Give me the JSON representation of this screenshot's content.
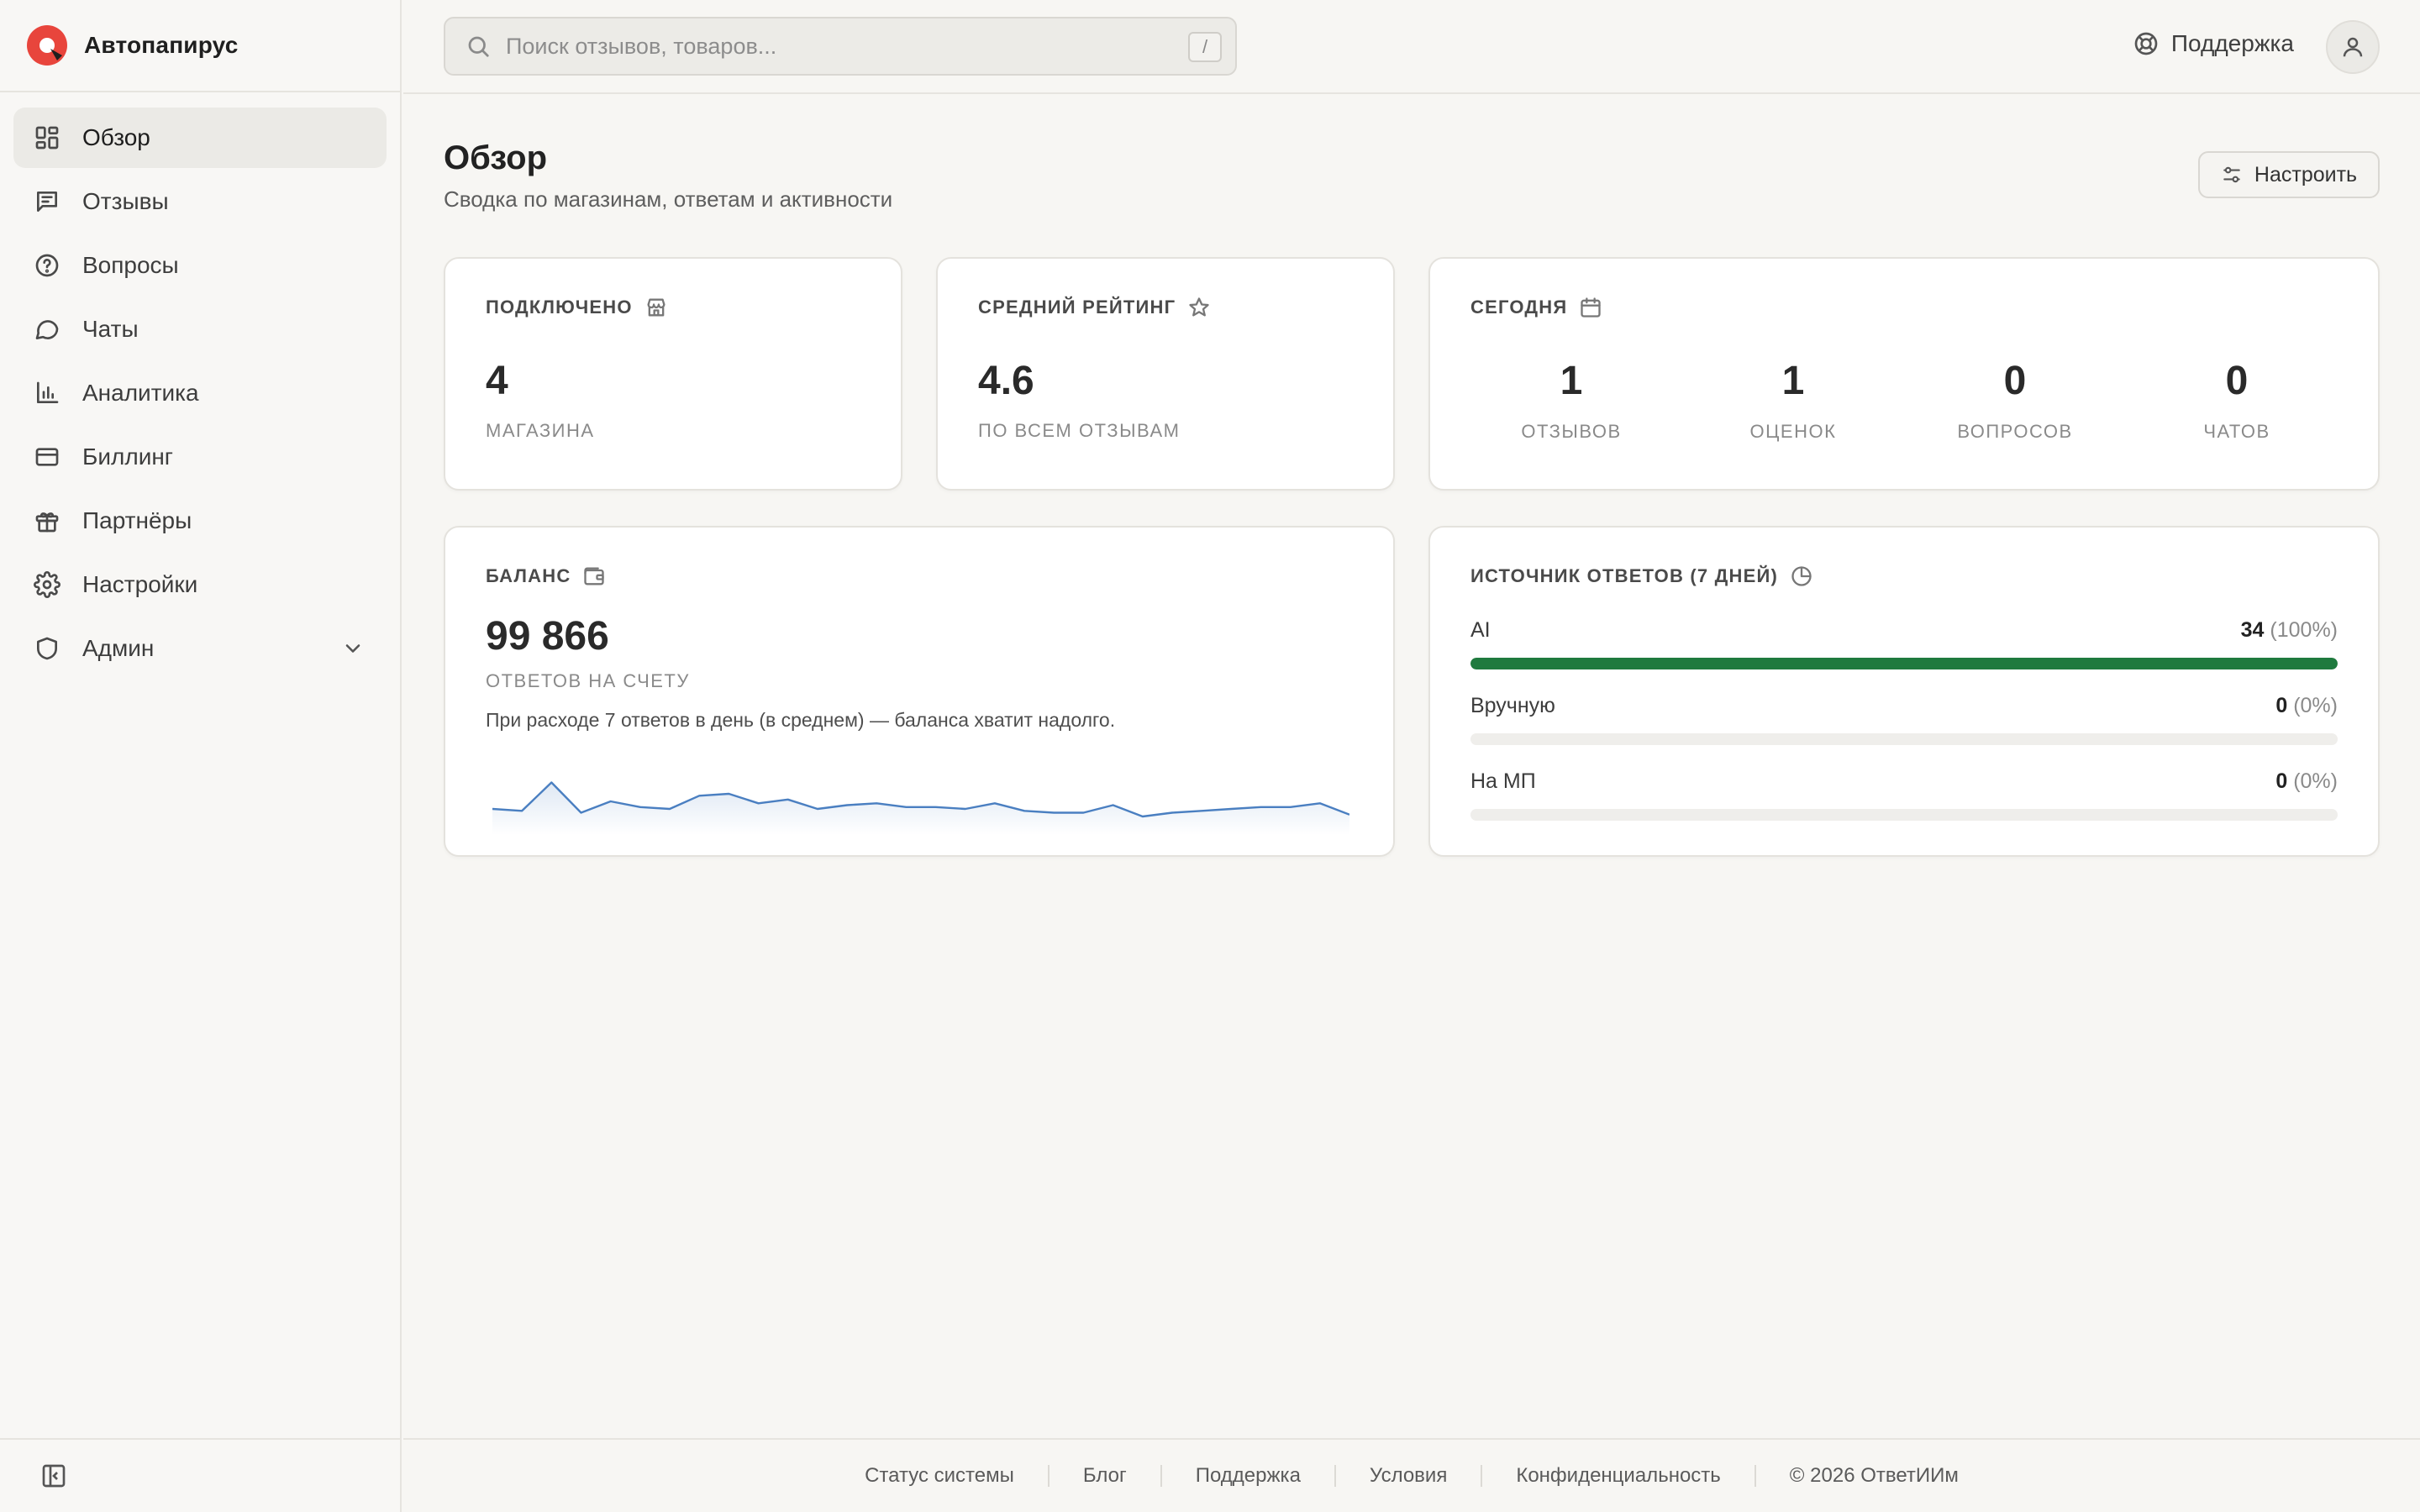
{
  "brand": {
    "name": "Автопапирус",
    "accent": "#e8453c"
  },
  "sidebar": {
    "items": [
      {
        "label": "Обзор",
        "icon": "dashboard-icon",
        "active": true
      },
      {
        "label": "Отзывы",
        "icon": "reviews-icon"
      },
      {
        "label": "Вопросы",
        "icon": "question-icon"
      },
      {
        "label": "Чаты",
        "icon": "chat-icon"
      },
      {
        "label": "Аналитика",
        "icon": "bar-chart-icon"
      },
      {
        "label": "Биллинг",
        "icon": "credit-card-icon"
      },
      {
        "label": "Партнёры",
        "icon": "gift-icon"
      },
      {
        "label": "Настройки",
        "icon": "gear-icon"
      },
      {
        "label": "Админ",
        "icon": "shield-icon",
        "expandable": true
      }
    ]
  },
  "header": {
    "search_placeholder": "Поиск отзывов, товаров...",
    "search_shortcut": "/",
    "support_label": "Поддержка"
  },
  "page": {
    "title": "Обзор",
    "subtitle": "Сводка по магазинам, ответам и активности",
    "customize_label": "Настроить"
  },
  "cards": {
    "connected": {
      "title": "Подключено",
      "value": "4",
      "caption": "магазина"
    },
    "rating": {
      "title": "Средний рейтинг",
      "value": "4.6",
      "caption": "по всем отзывам"
    },
    "today": {
      "title": "Сегодня",
      "stats": [
        {
          "value": "1",
          "label": "отзывов"
        },
        {
          "value": "1",
          "label": "оценок"
        },
        {
          "value": "0",
          "label": "вопросов"
        },
        {
          "value": "0",
          "label": "чатов"
        }
      ]
    },
    "balance": {
      "title": "Баланс",
      "value": "99 866",
      "caption": "ответов на счету",
      "note": "При расходе 7 ответов в день (в среднем) — баланса хватит надолго."
    },
    "sources": {
      "title": "Источник ответов (7 дней)",
      "rows": [
        {
          "label": "AI",
          "count": "34",
          "pct": "(100%)",
          "fraction": 1.0
        },
        {
          "label": "Вручную",
          "count": "0",
          "pct": "(0%)",
          "fraction": 0
        },
        {
          "label": "На МП",
          "count": "0",
          "pct": "(0%)",
          "fraction": 0
        }
      ],
      "bar_color": "#1f7a3e"
    }
  },
  "chart_data": {
    "type": "line",
    "values": [
      6,
      5.5,
      13,
      5,
      8,
      6.5,
      6,
      9.5,
      10,
      7.5,
      8.5,
      6,
      7,
      7.5,
      6.5,
      6.5,
      6,
      7.5,
      5.5,
      5,
      5,
      7,
      4,
      5,
      5.5,
      6,
      6.5,
      6.5,
      7.5,
      4.5
    ],
    "ylim": [
      0,
      16
    ],
    "color": "#4a7fc1"
  },
  "footer": {
    "links": [
      "Статус системы",
      "Блог",
      "Поддержка",
      "Условия",
      "Конфиденциальность"
    ],
    "copyright": "© 2026 ОтветИИм"
  }
}
